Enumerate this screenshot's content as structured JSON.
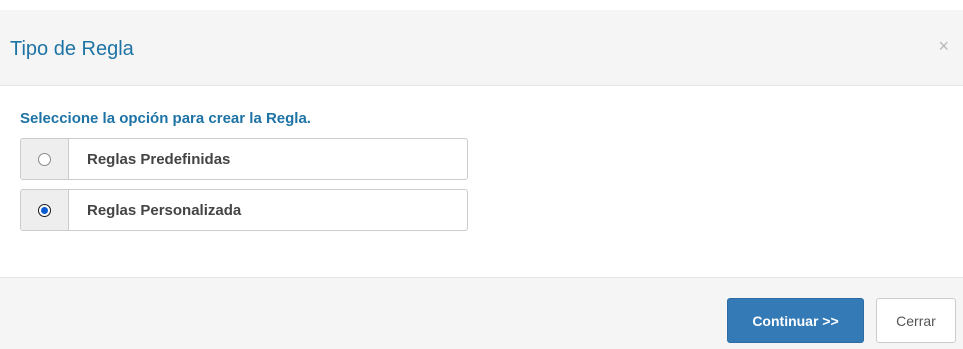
{
  "dialog": {
    "title": "Tipo de Regla",
    "close_glyph": "×"
  },
  "body": {
    "instruction": "Seleccione la opción para crear la Regla.",
    "options": [
      {
        "label": "Reglas Predefinidas",
        "selected": false
      },
      {
        "label": "Reglas Personalizada",
        "selected": true
      }
    ]
  },
  "footer": {
    "continue_label": "Continuar >>",
    "close_label": "Cerrar"
  },
  "colors": {
    "title": "#1e73a5",
    "primary_button": "#337ab7",
    "radio_selected": "#0a5bd1",
    "header_footer_bg": "#f5f5f5"
  },
  "icons": {
    "close": "close-icon",
    "radio_unchecked": "radio-unchecked-icon",
    "radio_checked": "radio-checked-icon"
  }
}
